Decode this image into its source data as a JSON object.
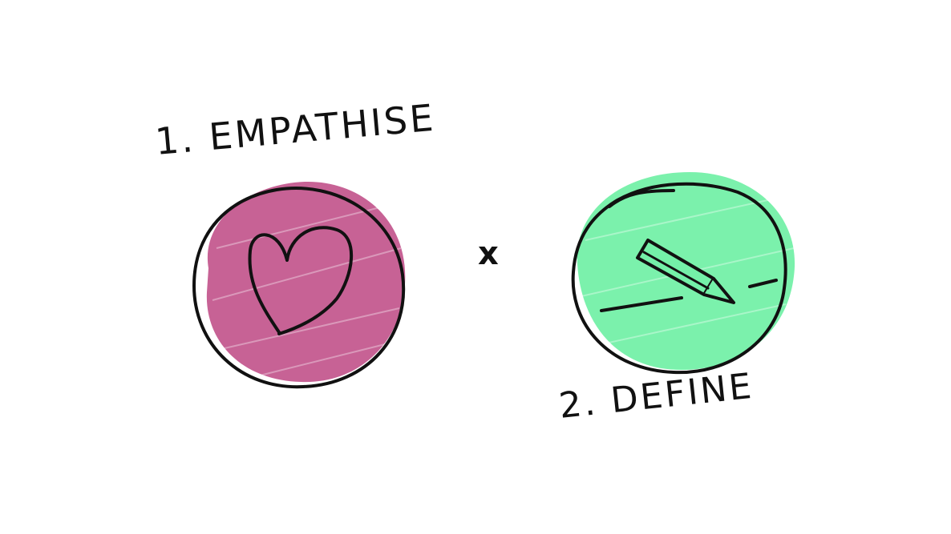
{
  "stages": [
    {
      "label": "1. EMPATHISE",
      "icon": "heart-icon",
      "fill_color": "#c45a8f"
    },
    {
      "label": "2. DEFINE",
      "icon": "pencil-icon",
      "fill_color": "#74f0a8"
    }
  ],
  "operator": "x",
  "stroke_color": "#111111"
}
